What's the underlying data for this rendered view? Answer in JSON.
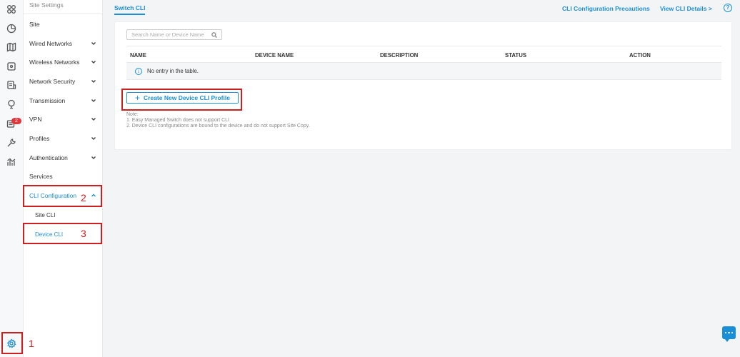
{
  "rail": {
    "icons": [
      "dashboard-icon",
      "chart-pie-icon",
      "map-icon",
      "device-icon",
      "log-icon",
      "location-icon",
      "alerts-icon",
      "tools-icon",
      "insight-icon",
      "settings-icon"
    ],
    "badge": "2"
  },
  "menu": {
    "header": "Site Settings",
    "items": [
      {
        "label": "Site"
      },
      {
        "label": "Wired Networks"
      },
      {
        "label": "Wireless Networks"
      },
      {
        "label": "Network Security"
      },
      {
        "label": "Transmission"
      },
      {
        "label": "VPN"
      },
      {
        "label": "Profiles"
      },
      {
        "label": "Authentication"
      },
      {
        "label": "Services"
      },
      {
        "label": "CLI Configuration"
      },
      {
        "label": "Site CLI"
      },
      {
        "label": "Device CLI"
      }
    ]
  },
  "tabs": {
    "active": "Switch CLI"
  },
  "links": {
    "precautions": "CLI Configuration Precautions",
    "details": "View CLI Details >",
    "help": "?"
  },
  "search": {
    "placeholder": "Search Name or Device Name"
  },
  "table": {
    "headers": [
      "NAME",
      "DEVICE NAME",
      "DESCRIPTION",
      "STATUS",
      "ACTION"
    ],
    "empty_text": "No entry in the table."
  },
  "create_button": "Create New Device CLI Profile",
  "note": {
    "title": "Note:",
    "lines": [
      "1. Easy Managed Switch does not support CLI",
      "2. Device CLI configurations are bound to the device and do not support Site Copy."
    ]
  },
  "annotations": [
    "1",
    "2",
    "3"
  ],
  "colors": {
    "accent": "#1a8fd8",
    "annotation": "#cc1f1f",
    "badge": "#e0363c"
  }
}
